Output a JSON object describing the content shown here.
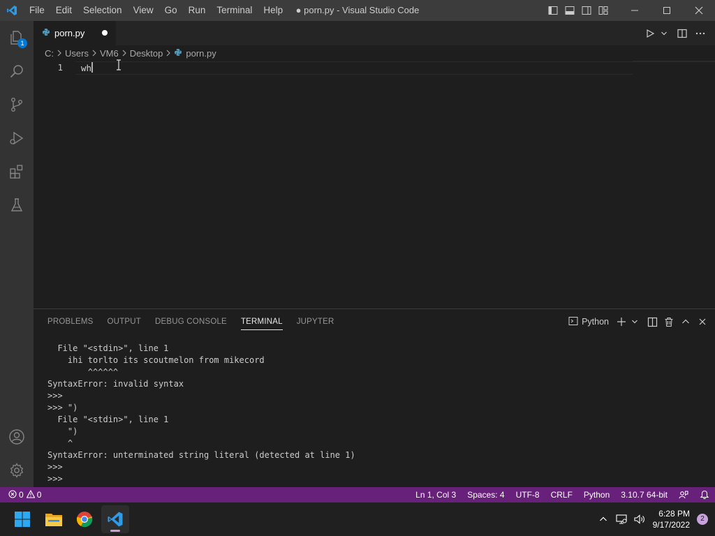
{
  "titlebar": {
    "menu": [
      "File",
      "Edit",
      "Selection",
      "View",
      "Go",
      "Run",
      "Terminal",
      "Help"
    ],
    "window_title": "● porn.py - Visual Studio Code",
    "window_controls": [
      "minimize-icon",
      "maximize-icon",
      "close-icon"
    ]
  },
  "activitybar": {
    "items": [
      "explorer-icon",
      "search-icon",
      "source-control-icon",
      "run-debug-icon",
      "extensions-icon",
      "testing-icon"
    ],
    "explorer_badge": "1",
    "bottom_items": [
      "accounts-icon",
      "manage-icon"
    ]
  },
  "editor": {
    "tab": {
      "label": "porn.py",
      "dirty": true
    },
    "breadcrumb": [
      "C:",
      "Users",
      "VM6",
      "Desktop",
      "porn.py"
    ],
    "lines": [
      {
        "number": "1",
        "text": "wh"
      }
    ]
  },
  "panel": {
    "tabs": [
      "PROBLEMS",
      "OUTPUT",
      "DEBUG CONSOLE",
      "TERMINAL",
      "JUPYTER"
    ],
    "active_tab": "TERMINAL",
    "terminal_profile": "Python",
    "terminal_lines": [
      "  File \"<stdin>\", line 1",
      "    ihi torlto its scoutmelon from mikecord",
      "        ^^^^^^",
      "SyntaxError: invalid syntax",
      ">>>",
      ">>> \")",
      "  File \"<stdin>\", line 1",
      "    \")",
      "    ^",
      "SyntaxError: unterminated string literal (detected at line 1)",
      ">>>",
      ">>>"
    ]
  },
  "statusbar": {
    "errors": "0",
    "warnings": "0",
    "position": "Ln 1, Col 3",
    "spaces": "Spaces: 4",
    "encoding": "UTF-8",
    "eol": "CRLF",
    "language": "Python",
    "interpreter": "3.10.7 64-bit",
    "color": "#68217a"
  },
  "taskbar": {
    "apps": [
      "start-icon",
      "file-explorer-icon",
      "chrome-icon",
      "vscode-icon"
    ],
    "time": "6:28 PM",
    "date": "9/17/2022",
    "notifications": "2"
  }
}
